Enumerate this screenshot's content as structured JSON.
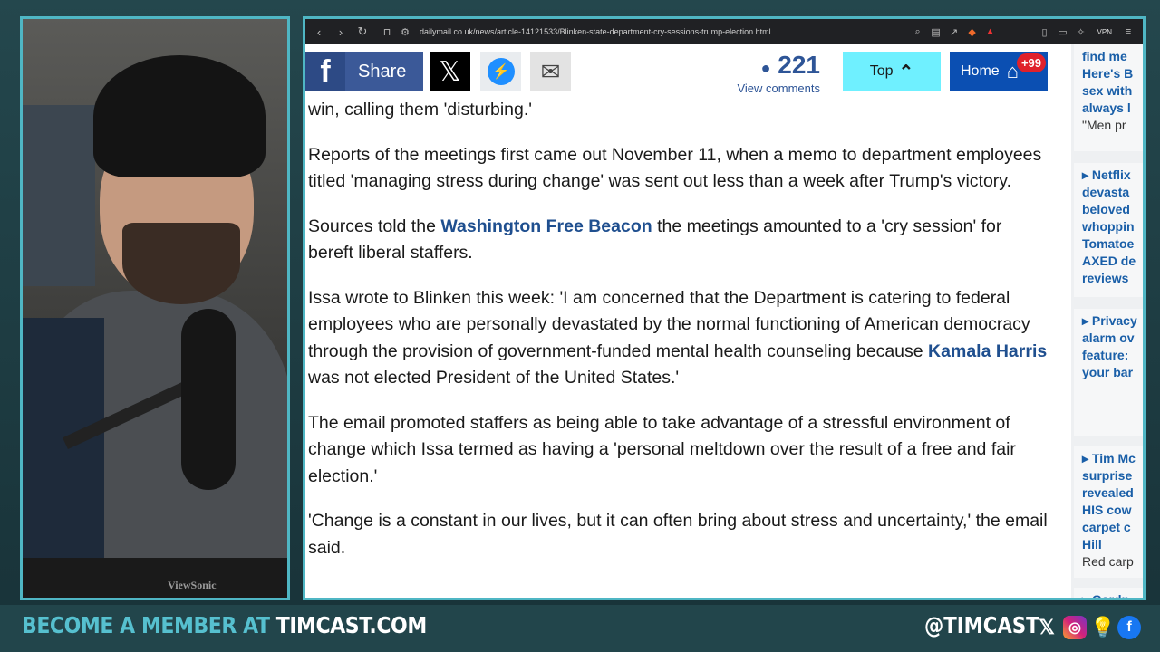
{
  "browser": {
    "url": "dailymail.co.uk/news/article-14121533/Blinken-state-department-cry-sessions-trump-election.html",
    "vpn_label": "VPN"
  },
  "sharebar": {
    "share_label": "Share",
    "comment_count": "221",
    "view_comments": "View comments",
    "top_label": "Top",
    "home_label": "Home",
    "home_badge": "+99"
  },
  "article": {
    "p0": "win, calling them 'disturbing.'",
    "p1": "Reports of the meetings first came out November 11, when a memo to department employees titled 'managing stress during change' was sent out less than a week after Trump's victory.",
    "p2_pre": "Sources told the ",
    "p2_link": "Washington Free Beacon",
    "p2_post": " the meetings amounted to a 'cry session' for bereft liberal staffers.",
    "p3_pre": "Issa wrote to Blinken this week: 'I am concerned that the Department is catering to federal employees who are personally devastated by the normal functioning of American democracy through the provision of government-funded mental health counseling because ",
    "p3_link": "Kamala Harris",
    "p3_post": " was not elected President of the United States.'",
    "p4": "The email promoted staffers as being able to take advantage of a stressful environment of change which Issa termed as having a 'personal meltdown over the result of a free and fair election.'",
    "p5": "'Change is a constant in our lives, but it can often bring about stress and uncertainty,' the email said."
  },
  "sidebar": {
    "items": [
      {
        "lines": [
          "find me",
          "Here's B",
          "sex with",
          "always l"
        ],
        "sub": "\"Men pr"
      },
      {
        "lines": [
          "▸ Netflix",
          "devasta",
          "beloved",
          "whoppin",
          "Tomatoe",
          "AXED de",
          "reviews"
        ],
        "sub": ""
      },
      {
        "lines": [
          "▸ Privacy",
          "alarm ov",
          "feature:",
          "your bar"
        ],
        "sub": ""
      },
      {
        "lines": [
          "▸ Tim Mc",
          "surprise",
          "revealed",
          "HIS cow",
          "carpet c",
          "Hill"
        ],
        "sub": "Red carp"
      },
      {
        "lines": [
          "▸ Gardn"
        ],
        "sub": ""
      }
    ]
  },
  "camera": {
    "monitor_brand": "ViewSonic"
  },
  "footer": {
    "cta_prefix": "BECOME A MEMBER AT ",
    "cta_site": "TIMCAST.COM",
    "handle": "@TIMCAST"
  },
  "colors": {
    "accent": "#4fb6c4",
    "facebook": "#3b5998",
    "top_button": "#6ff0ff",
    "home_button": "#0b4fb2",
    "link": "#1f4f8f"
  }
}
